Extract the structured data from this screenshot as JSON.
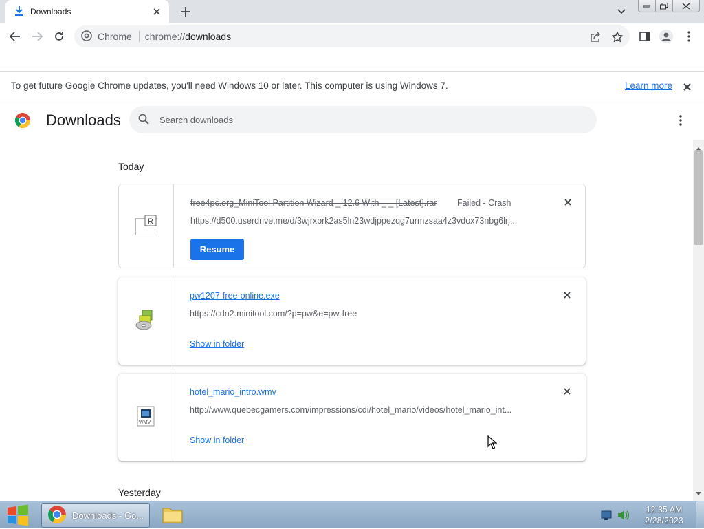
{
  "tab": {
    "title": "Downloads",
    "icon": "download-icon"
  },
  "toolbar": {
    "site_chip": "Chrome",
    "url_scheme": "chrome://",
    "url_host": "downloads"
  },
  "infobar": {
    "message": "To get future Google Chrome updates, you'll need Windows 10 or later. This computer is using Windows 7.",
    "learn_more": "Learn more"
  },
  "header": {
    "title": "Downloads",
    "search_placeholder": "Search downloads"
  },
  "sections": [
    {
      "label": "Today"
    },
    {
      "label": "Yesterday"
    }
  ],
  "downloads": [
    {
      "filename": "free4pc.org_MiniTool Partition Wizard _ 12.6 With _ _ [Latest].rar",
      "status": "Failed - Crash",
      "url": "https://d500.userdrive.me/d/3wjrxbrk2as5ln23wdjppezqg7urmzsaa4z3vdox73nbg6lrj...",
      "action": "Resume",
      "icon": "rar-file-icon"
    },
    {
      "filename": "pw1207-free-online.exe",
      "status": "",
      "url": "https://cdn2.minitool.com/?p=pw&e=pw-free",
      "action": "Show in folder",
      "icon": "installer-icon"
    },
    {
      "filename": "hotel_mario_intro.wmv",
      "status": "",
      "url": "http://www.quebecgamers.com/impressions/cdi/hotel_mario/videos/hotel_mario_int...",
      "action": "Show in folder",
      "icon": "wmv-file-icon"
    }
  ],
  "taskbar": {
    "app_label": "Downloads - Go...",
    "time": "12:35 AM",
    "date": "2/28/2023"
  },
  "colors": {
    "accent": "#1a73e8",
    "tabstrip": "#dee1e6",
    "omnibox": "#f1f3f4"
  }
}
